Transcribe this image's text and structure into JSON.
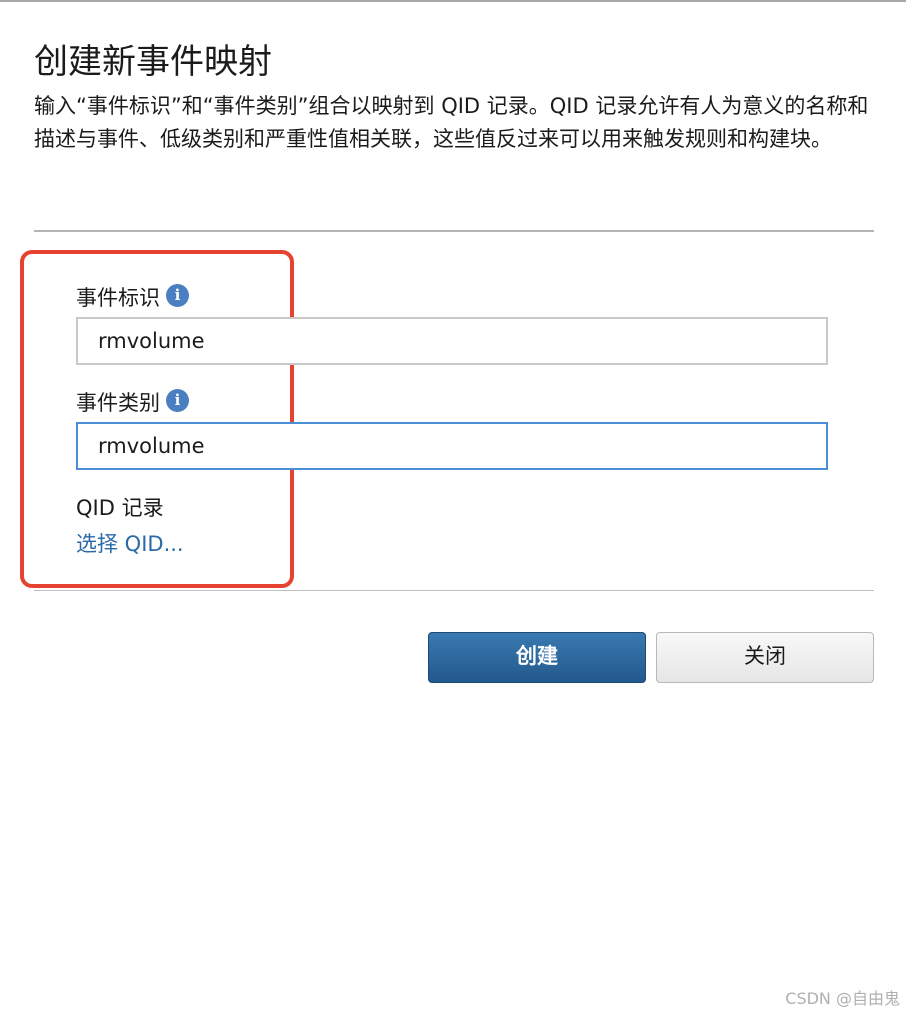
{
  "dialog": {
    "title": "创建新事件映射",
    "description": "输入“事件标识”和“事件类别”组合以映射到 QID 记录。QID 记录允许有人为意义的名称和描述与事件、低级类别和严重性值相关联，这些值反过来可以用来触发规则和构建块。"
  },
  "form": {
    "event_id": {
      "label": "事件标识",
      "value": "rmvolume"
    },
    "event_category": {
      "label": "事件类别",
      "value": "rmvolume"
    },
    "qid": {
      "label": "QID 记录",
      "link_text": "选择 QID..."
    }
  },
  "buttons": {
    "create_label": "创建",
    "close_label": "关闭"
  },
  "icons": {
    "info": "info-icon",
    "info_glyph": "i"
  },
  "colors": {
    "accent": "#22598d",
    "link": "#2a6aa8",
    "highlight": "#e5432f",
    "info_icon": "#4a7fc1"
  },
  "watermark": "CSDN @自由鬼"
}
